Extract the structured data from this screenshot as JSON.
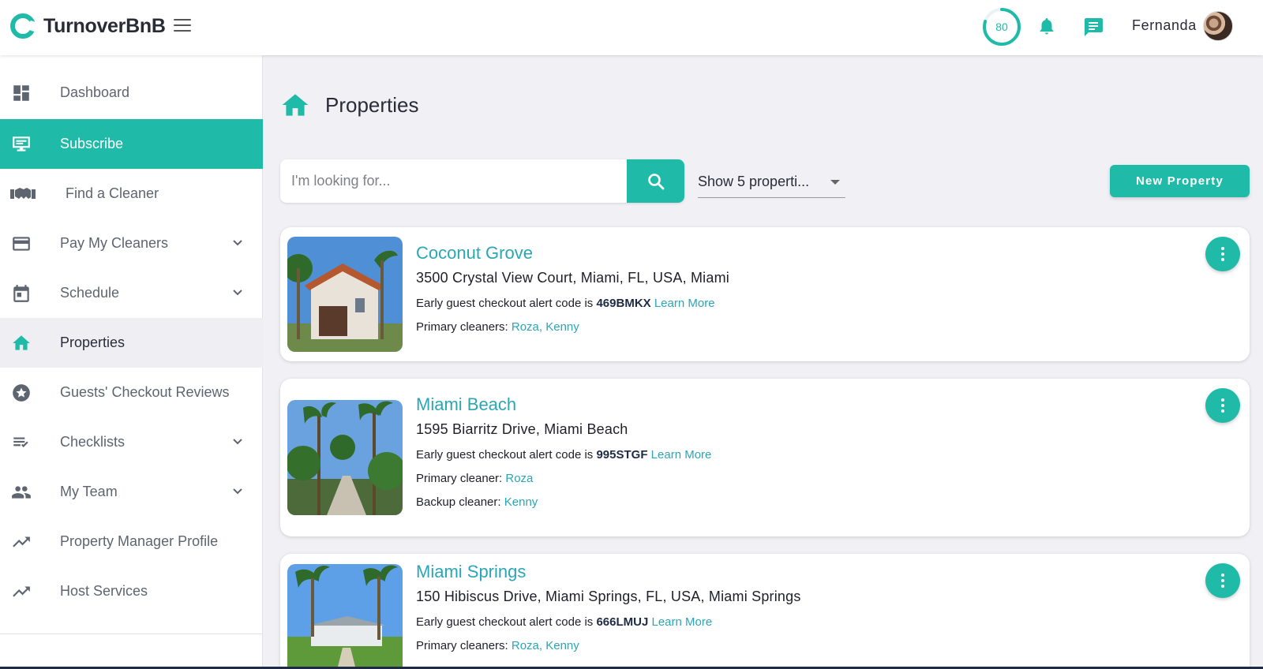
{
  "app": {
    "name": "TurnoverBnB",
    "progress": 80,
    "user_name": "Fernanda",
    "accent_color": "#20bba8",
    "link_color": "#2aa6b6"
  },
  "sidebar": {
    "items": [
      {
        "label": "Dashboard",
        "icon": "dashboard-icon"
      },
      {
        "label": "Subscribe",
        "icon": "subscribe-icon",
        "state": "active"
      },
      {
        "label": "Find a Cleaner",
        "icon": "handshake-icon"
      },
      {
        "label": "Pay My Cleaners",
        "icon": "credit-card-icon",
        "expandable": true
      },
      {
        "label": "Schedule",
        "icon": "calendar-icon",
        "expandable": true
      },
      {
        "label": "Properties",
        "icon": "home-icon",
        "state": "selected"
      },
      {
        "label": "Guests' Checkout Reviews",
        "icon": "star-icon"
      },
      {
        "label": "Checklists",
        "icon": "checklist-icon",
        "expandable": true
      },
      {
        "label": "My Team",
        "icon": "people-icon",
        "expandable": true
      },
      {
        "label": "Property Manager Profile",
        "icon": "trending-up-icon"
      },
      {
        "label": "Host Services",
        "icon": "trending-up-icon"
      }
    ]
  },
  "main": {
    "title": "Properties",
    "search": {
      "placeholder": "I'm looking for..."
    },
    "show_select": {
      "value": "Show 5 properti..."
    },
    "new_property_label": "New Property",
    "properties": [
      {
        "name": "Coconut Grove",
        "address": "3500 Crystal View Court, Miami, FL, USA, Miami",
        "alert_prefix": "Early guest checkout alert code is",
        "alert_code": "469BMKX",
        "learn_more": "Learn More",
        "lines": [
          {
            "label": "Primary cleaners:",
            "value": "Roza, Kenny"
          }
        ]
      },
      {
        "name": "Miami Beach",
        "address": "1595 Biarritz Drive, Miami Beach",
        "alert_prefix": "Early guest checkout alert code is",
        "alert_code": "995STGF",
        "learn_more": "Learn More",
        "lines": [
          {
            "label": "Primary cleaner:",
            "value": "Roza"
          },
          {
            "label": "Backup cleaner:",
            "value": "Kenny"
          }
        ]
      },
      {
        "name": "Miami Springs",
        "address": "150 Hibiscus Drive, Miami Springs, FL, USA, Miami Springs",
        "alert_prefix": "Early guest checkout alert code is",
        "alert_code": "666LMUJ",
        "learn_more": "Learn More",
        "lines": [
          {
            "label": "Primary cleaners:",
            "value": "Roza, Kenny"
          }
        ]
      }
    ]
  }
}
